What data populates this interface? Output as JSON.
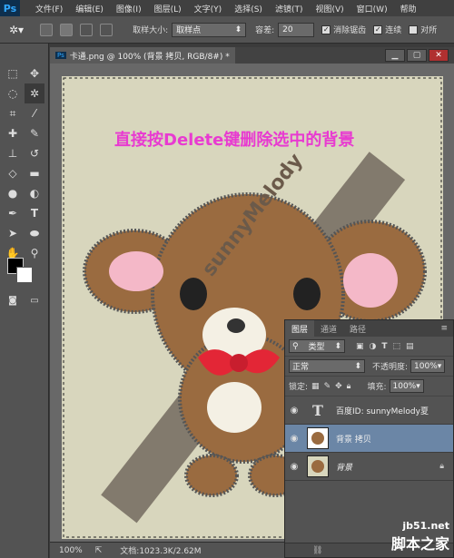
{
  "app": {
    "logo": "Ps"
  },
  "menu": [
    "文件(F)",
    "编辑(E)",
    "图像(I)",
    "图层(L)",
    "文字(Y)",
    "选择(S)",
    "滤镜(T)",
    "视图(V)",
    "窗口(W)",
    "帮助"
  ],
  "options": {
    "sample_size_label": "取样大小:",
    "sample_size_value": "取样点",
    "tolerance_label": "容差:",
    "tolerance_value": "20",
    "antialias_label": "消除锯齿",
    "contiguous_label": "连续",
    "all_layers_label": "对所"
  },
  "document": {
    "tab_title": "卡通.png @ 100% (背景 拷贝, RGB/8#) *",
    "canvas_text": "直接按Delete键删除选中的背景",
    "watermark_text": "sunnyMelody"
  },
  "status": {
    "zoom": "100%",
    "doc_info": "文档:1023.3K/2.62M"
  },
  "layers_panel": {
    "tabs": [
      "图层",
      "通道",
      "路径"
    ],
    "filter_label": "类型",
    "blend_mode": "正常",
    "opacity_label": "不透明度:",
    "opacity_value": "100%",
    "lock_label": "锁定:",
    "fill_label": "填充:",
    "fill_value": "100%",
    "layers": [
      {
        "name": "百度ID: sunnyMelody夏",
        "type_thumb": "T"
      },
      {
        "name": "背景 拷贝"
      },
      {
        "name": "背景"
      }
    ]
  },
  "site_watermark": {
    "domain": "jb51.net",
    "brand": "脚本之家"
  },
  "colors": {
    "accent_text": "#e83ad1",
    "selected_layer": "#6b86a6",
    "canvas_bg": "#d8d6bd"
  }
}
